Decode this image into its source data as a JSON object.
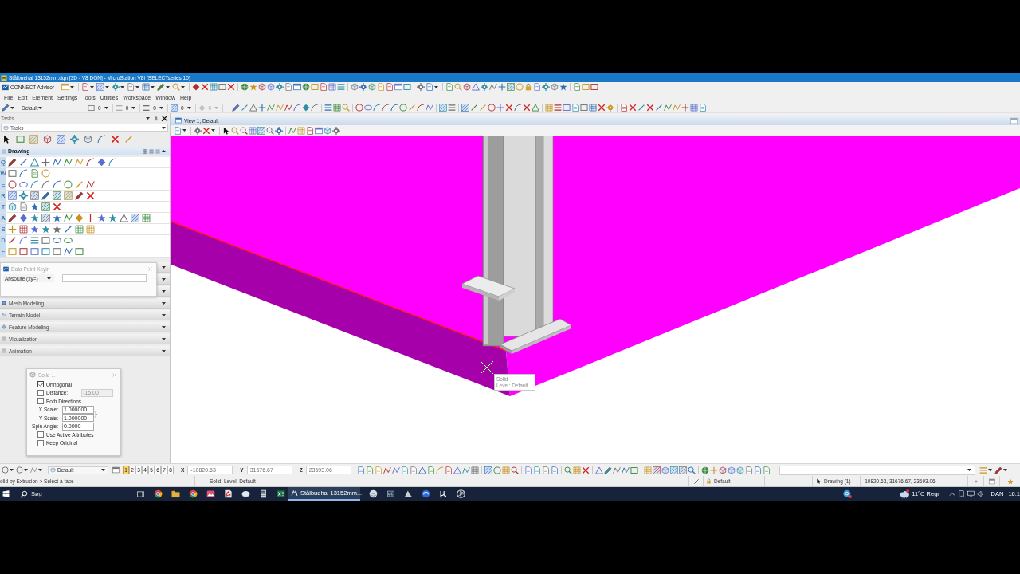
{
  "window": {
    "title": "Stålbuehal 13152mm.dgn [3D - V8 DGN] - MicroStation V8i (SELECTseries 10)"
  },
  "advisor_toolbar": {
    "label": "CONNECT Advisor"
  },
  "menu": [
    {
      "label": "File"
    },
    {
      "label": "Edit"
    },
    {
      "label": "Element"
    },
    {
      "label": "Settings"
    },
    {
      "label": "Tools"
    },
    {
      "label": "Utilities"
    },
    {
      "label": "Workspace"
    },
    {
      "label": "Window"
    },
    {
      "label": "Help"
    }
  ],
  "attributes_toolbar": {
    "level": "Default",
    "fields": [
      {
        "value": "0",
        "disabled": false
      },
      {
        "value": "0",
        "disabled": false
      },
      {
        "value": "0",
        "disabled": false
      },
      {
        "value": "0",
        "disabled": false
      },
      {
        "value": "0",
        "disabled": true
      }
    ]
  },
  "tasks_panel": {
    "title": "Tasks",
    "task_combo": "Tasks",
    "section": {
      "title": "Drawing",
      "expanded": true,
      "rows": [
        {
          "key": "Q"
        },
        {
          "key": "W"
        },
        {
          "key": "E"
        },
        {
          "key": "R"
        },
        {
          "key": "T"
        },
        {
          "key": "A"
        },
        {
          "key": "S"
        },
        {
          "key": "D"
        },
        {
          "key": "F"
        }
      ]
    },
    "collapsed_sections": [
      {
        "title": "Mesh Modeling",
        "expanded": false
      },
      {
        "title": "Terrain Model",
        "expanded": false
      },
      {
        "title": "Feature Modeling",
        "expanded": false
      },
      {
        "title": "Visualization",
        "expanded": false
      },
      {
        "title": "Animation",
        "expanded": false
      }
    ]
  },
  "data_point_keyin": {
    "title": "Data Point Keyin",
    "mode": "Absolute (xy=)"
  },
  "solid_dialog": {
    "title": "Solid ...",
    "options": [
      {
        "kind": "checkbox",
        "label": "Orthogonal",
        "checked": true
      },
      {
        "kind": "checkbox_field",
        "label": "Distance:",
        "checked": false,
        "value": "-15.00",
        "disabled": true
      },
      {
        "kind": "checkbox",
        "label": "Both Directions",
        "checked": false
      },
      {
        "kind": "field",
        "label": "X Scale:",
        "value": "1.000000"
      },
      {
        "kind": "field",
        "label": "Y Scale:",
        "value": "1.000000"
      },
      {
        "kind": "field",
        "label": "Spin Angle:",
        "value": "0.0000"
      },
      {
        "kind": "checkbox",
        "label": "Use Active Attributes",
        "checked": false
      },
      {
        "kind": "checkbox",
        "label": "Keep Original",
        "checked": false
      }
    ]
  },
  "view": {
    "title": "View 1, Default",
    "cursor_tip": [
      "Solid",
      "Level: Default"
    ]
  },
  "bottom_toolbar": {
    "level": "Default",
    "views": [
      {
        "label": "1",
        "selected": true
      },
      {
        "label": "2",
        "selected": false
      },
      {
        "label": "3",
        "selected": false
      },
      {
        "label": "4",
        "selected": false
      },
      {
        "label": "5",
        "selected": false
      },
      {
        "label": "6",
        "selected": false
      },
      {
        "label": "7",
        "selected": false
      },
      {
        "label": "8",
        "selected": false
      }
    ],
    "coordinates": [
      {
        "axis": "X",
        "value": "-10820.63"
      },
      {
        "axis": "Y",
        "value": "31676.67"
      },
      {
        "axis": "Z",
        "value": "23693.06"
      }
    ]
  },
  "status_bar": {
    "prompt": "olid by Extrusion > Select a face",
    "message": "Solid, Level: Default",
    "active_level": "Default",
    "model": "Drawing (1)",
    "coordinates": "-10820.63, 31676.67, 23693.06"
  },
  "taskbar": {
    "search": {
      "placeholder": "Søg"
    },
    "active_app": {
      "label": "Stålbuehal 13152mm..."
    },
    "weather": "11°C Regn",
    "language": "DAN",
    "clock": "16:1"
  }
}
